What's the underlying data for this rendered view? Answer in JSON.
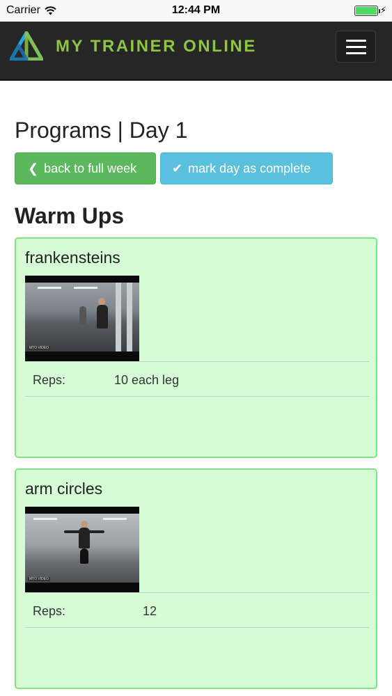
{
  "status_bar": {
    "carrier": "Carrier",
    "time": "12:44 PM",
    "wifi_icon": "wifi-icon",
    "battery_icon": "battery-icon"
  },
  "navbar": {
    "brand": "MY TRAINER ONLINE",
    "logo_icon": "triangle-logo-icon",
    "menu_icon": "hamburger-menu-icon",
    "brand_color": "#8dc63f",
    "background": "#262626"
  },
  "page": {
    "title": "Programs | Day 1",
    "back_button": "back to full week",
    "back_icon": "chevron-left-icon",
    "complete_button": "mark day as complete",
    "complete_icon": "check-icon",
    "section_title": "Warm Ups"
  },
  "exercises": [
    {
      "name": "frankensteins",
      "reps_label": "Reps:",
      "reps": "10 each leg",
      "thumbnail": "video-thumbnail-frankensteins"
    },
    {
      "name": "arm circles",
      "reps_label": "Reps:",
      "reps": "12",
      "thumbnail": "video-thumbnail-arm-circles"
    }
  ],
  "colors": {
    "back_button": "#5cb85c",
    "complete_button": "#5bc0de",
    "card_bg": "#d6fcd6",
    "card_border": "#7ee67e"
  }
}
